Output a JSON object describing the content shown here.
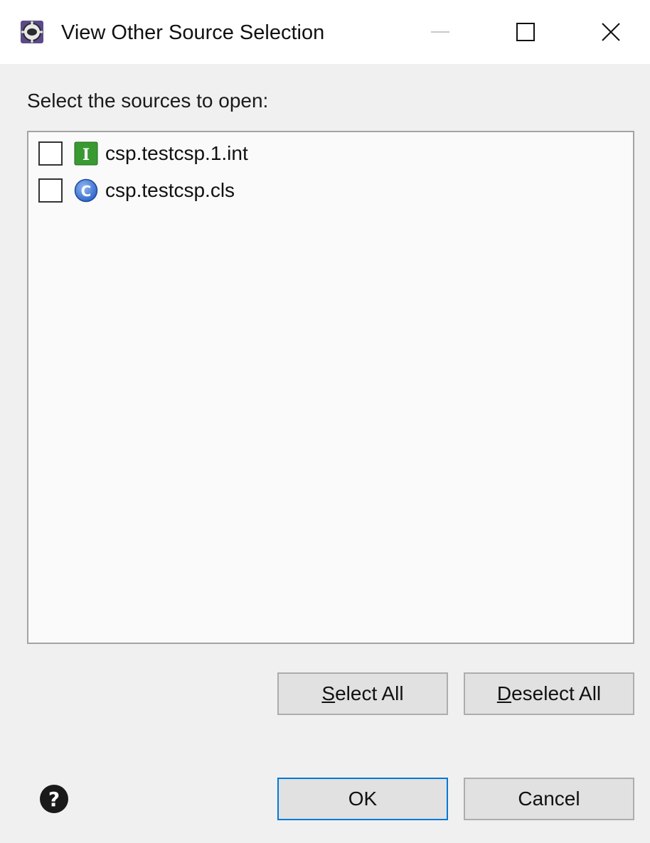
{
  "window": {
    "title": "View Other Source Selection",
    "icon": "eclipse-gear-icon",
    "controls": [
      "minimize-icon",
      "maximize-icon",
      "close-icon"
    ]
  },
  "dialog": {
    "prompt": "Select the sources to open:",
    "items": [
      {
        "label": "csp.testcsp.1.int",
        "icon": "include-file-icon",
        "icon_letter": "I",
        "checked": false
      },
      {
        "label": "csp.testcsp.cls",
        "icon": "class-file-icon",
        "icon_letter": "C",
        "checked": false
      }
    ],
    "buttons": {
      "select_all": {
        "mnemonic": "S",
        "rest": "elect All"
      },
      "deselect_all": {
        "mnemonic": "D",
        "rest": "eselect All"
      },
      "ok": "OK",
      "cancel": "Cancel"
    },
    "help_icon": "help-icon"
  },
  "colors": {
    "client_bg": "#f0f0f0",
    "list_bg": "#fafafa",
    "default_button_border": "#0078d7",
    "include_icon_green": "#3a9a32",
    "class_icon_blue": "#2a62c8"
  }
}
